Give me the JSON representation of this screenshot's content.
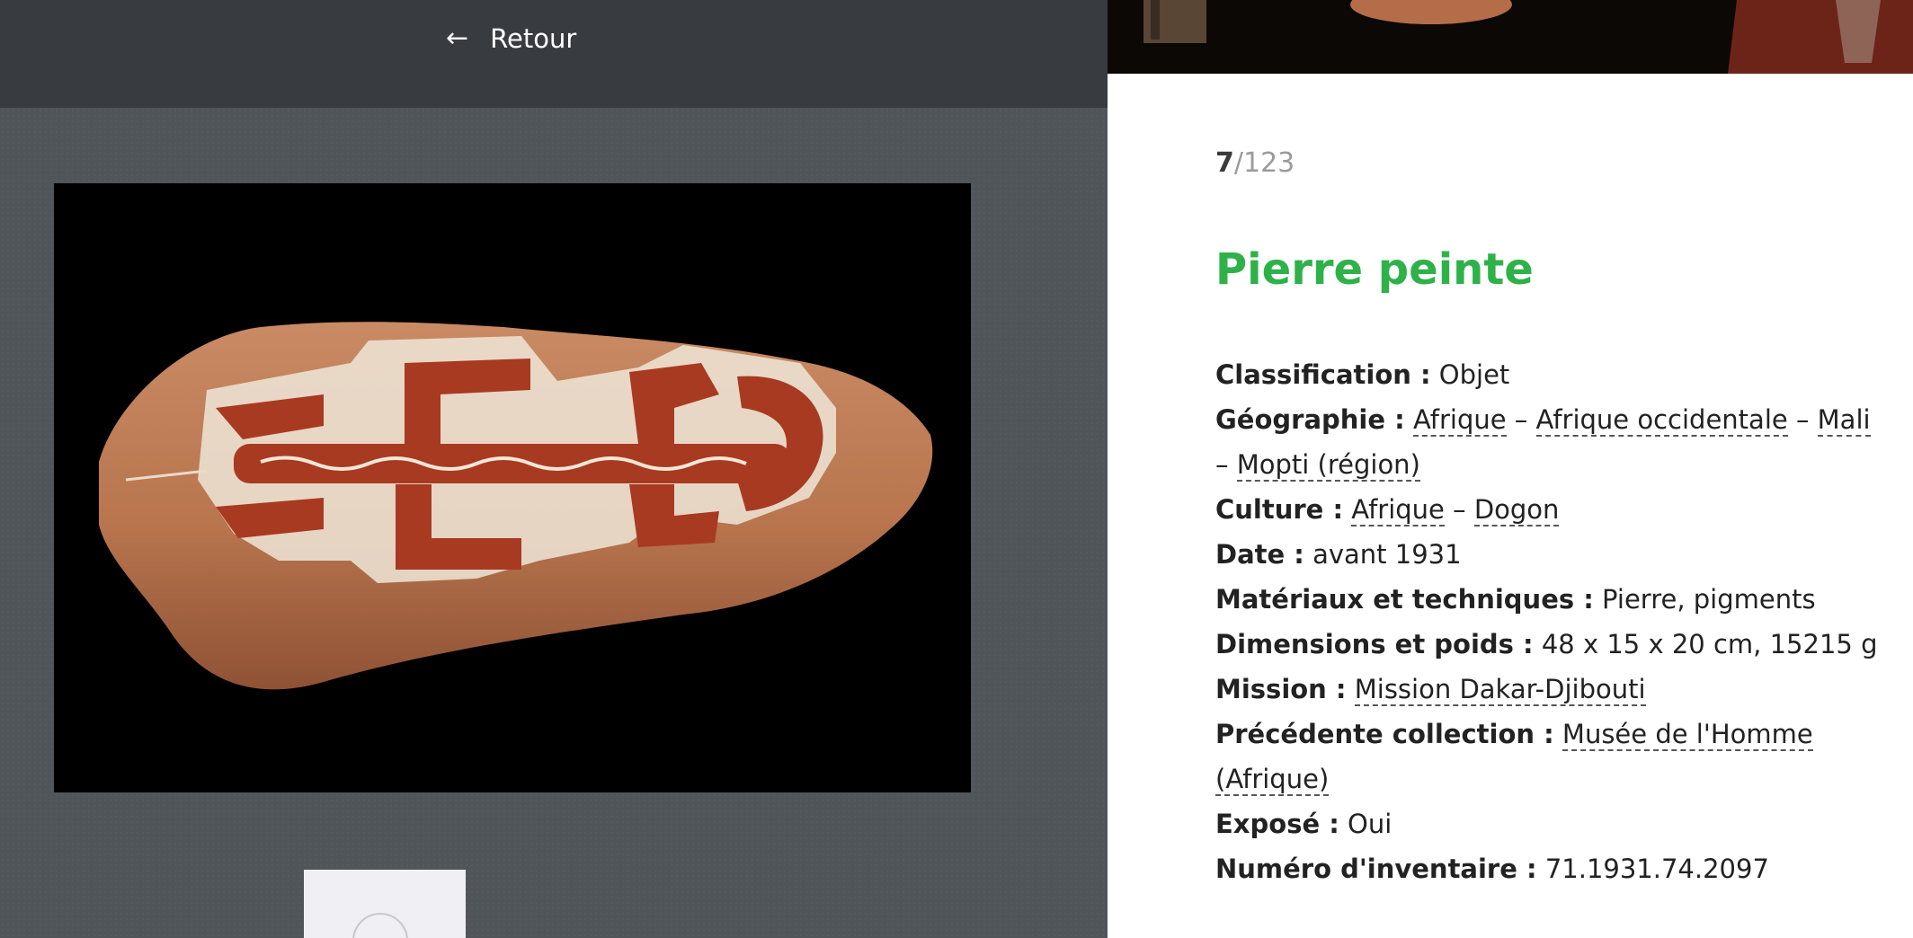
{
  "nav": {
    "back_label": "Retour",
    "back_icon": "arrow-left-icon"
  },
  "counter": {
    "current": "7",
    "total": "/123"
  },
  "object": {
    "title": "Pierre peinte",
    "title_color": "#2fb14a"
  },
  "fields": {
    "classification": {
      "label": "Classification :",
      "value": "Objet"
    },
    "geographie": {
      "label": "Géographie :",
      "links": [
        "Afrique",
        "Afrique occidentale",
        "Mali",
        "Mopti (région)"
      ],
      "separator": "–"
    },
    "culture": {
      "label": "Culture :",
      "links": [
        "Afrique",
        "Dogon"
      ],
      "separator": "–"
    },
    "date": {
      "label": "Date :",
      "value": "avant 1931"
    },
    "materiaux": {
      "label": "Matériaux et techniques :",
      "value": "Pierre, pigments"
    },
    "dimensions": {
      "label": "Dimensions et poids :",
      "value": "48 x 15 x 20 cm, 15215 g"
    },
    "mission": {
      "label": "Mission :",
      "link": "Mission Dakar-Djibouti"
    },
    "precedente": {
      "label": "Précédente collection :",
      "link": "Musée de l'Homme (Afrique)"
    },
    "expose": {
      "label": "Exposé :",
      "value": "Oui"
    },
    "inventaire": {
      "label": "Numéro d'inventaire :",
      "value": "71.1931.74.2097"
    }
  }
}
